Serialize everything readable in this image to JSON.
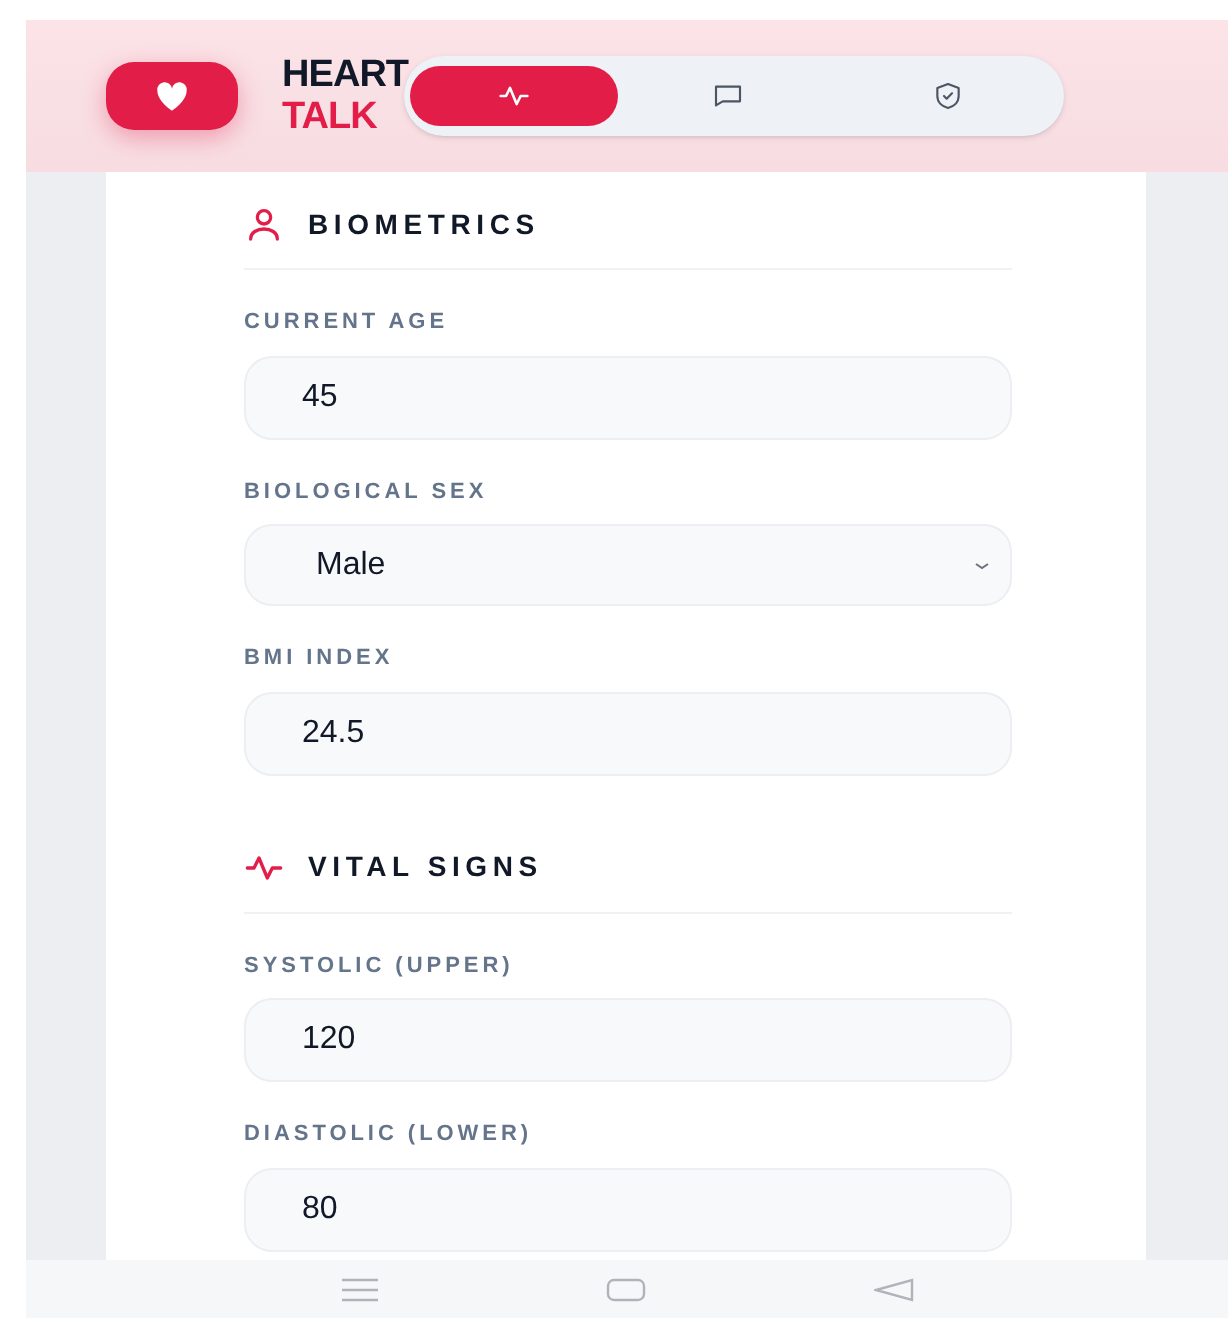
{
  "app": {
    "name_line_1": "HEART",
    "name_line_2": "TALK"
  },
  "nav_tabs": [
    {
      "kind": "pulse",
      "selected": true
    },
    {
      "kind": "chat",
      "selected": false
    },
    {
      "kind": "shield",
      "selected": false
    }
  ],
  "sections": [
    {
      "title": "BIOMETRICS",
      "kind": "person",
      "fields": [
        {
          "label": "CURRENT AGE",
          "kind": "input",
          "value": "45"
        },
        {
          "label": "BIOLOGICAL SEX",
          "kind": "select",
          "value": "Male"
        },
        {
          "label": "BMI INDEX",
          "kind": "input",
          "value": "24.5"
        }
      ]
    },
    {
      "title": "VITAL SIGNS",
      "kind": "pulse",
      "fields": [
        {
          "label": "SYSTOLIC (UPPER)",
          "kind": "input",
          "value": "120"
        },
        {
          "label": "DIASTOLIC (LOWER)",
          "kind": "input",
          "value": "80"
        }
      ]
    }
  ]
}
